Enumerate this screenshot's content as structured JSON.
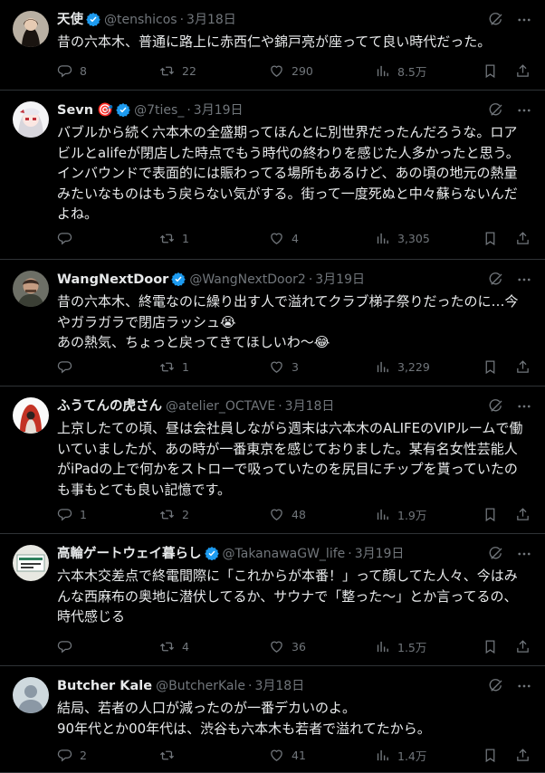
{
  "tweets": [
    {
      "name": "天使",
      "verified": true,
      "emoji": "",
      "handle": "@tenshicos",
      "date": "3月18日",
      "text": "昔の六本木、普通に路上に赤西仁や錦戸亮が座ってて良い時代だった。",
      "replies": "8",
      "retweets": "22",
      "likes": "290",
      "views": "8.5万",
      "avatar": "woman-portrait"
    },
    {
      "name": "Sevn",
      "verified": true,
      "emoji": "🎯",
      "handle": "@7ties_",
      "date": "3月19日",
      "text": "バブルから続く六本木の全盛期ってほんとに別世界だったんだろうな。ロア\nビルとalifeが閉店した時点でもう時代の終わりを感じた人多かったと思う。\nインバウンドで表面的には賑わってる場所もあるけど、あの頃の地元の熱量\nみたいなものはもう戻らない気がする。街って一度死ぬと中々蘇らないんだ\nよね。",
      "replies": "",
      "retweets": "1",
      "likes": "4",
      "views": "3,305",
      "avatar": "anime-girl"
    },
    {
      "name": "WangNextDoor",
      "verified": true,
      "emoji": "",
      "handle": "@WangNextDoor2",
      "date": "3月19日",
      "text": "昔の六本木、終電なのに繰り出す人で溢れてクラブ梯子祭りだったのに…今\nやガラガラで閉店ラッシュ😭\nあの熱気、ちょっと戻ってきてほしいわ〜😂",
      "replies": "",
      "retweets": "1",
      "likes": "3",
      "views": "3,229",
      "avatar": "man-portrait"
    },
    {
      "name": "ふうてんの虎さん",
      "verified": false,
      "emoji": "",
      "handle": "@atelier_OCTAVE",
      "date": "3月18日",
      "text": "上京したての頃、昼は会社員しながら週末は六本木のALIFEのVIPルームで働\nいていましたが、あの時が一番東京を感じておりました。某有名女性芸能人\nがiPadの上で何かをストローで吸っていたのを尻目にチップを貰っていたの\nも事もとても良い記憶です。",
      "replies": "1",
      "retweets": "2",
      "likes": "48",
      "views": "1.9万",
      "avatar": "hooded-figure"
    },
    {
      "name": "高輪ゲートウェイ暮らし",
      "verified": true,
      "emoji": "",
      "handle": "@TakanawaGW_life",
      "date": "3月19日",
      "text": "六本木交差点で終電間際に「これからが本番！」って顔してた人々、今はみ\nんな西麻布の奥地に潜伏してるか、サウナで「整った〜」とか言ってるの、\n時代感じる",
      "replies": "",
      "retweets": "4",
      "likes": "36",
      "views": "1.5万",
      "avatar": "station-sign"
    },
    {
      "name": "Butcher Kale",
      "verified": false,
      "emoji": "",
      "handle": "@ButcherKale",
      "date": "3月18日",
      "text": "結局、若者の人口が減ったのが一番デカいのよ。\n90年代とか00年代は、渋谷も六本木も若者で溢れてたから。",
      "replies": "2",
      "retweets": "",
      "likes": "41",
      "views": "1.4万",
      "avatar": "default-profile"
    }
  ],
  "icons": {
    "reply": "reply-icon",
    "retweet": "retweet-icon",
    "like": "like-icon",
    "views": "views-icon",
    "bookmark": "bookmark-icon",
    "share": "share-icon",
    "grok": "grok-icon",
    "more": "more-icon",
    "verified": "verified-badge-icon"
  },
  "colors": {
    "background": "#000000",
    "text": "#e7e9ea",
    "muted": "#71767b",
    "verified": "#1d9bf0",
    "border": "#2f3336"
  }
}
